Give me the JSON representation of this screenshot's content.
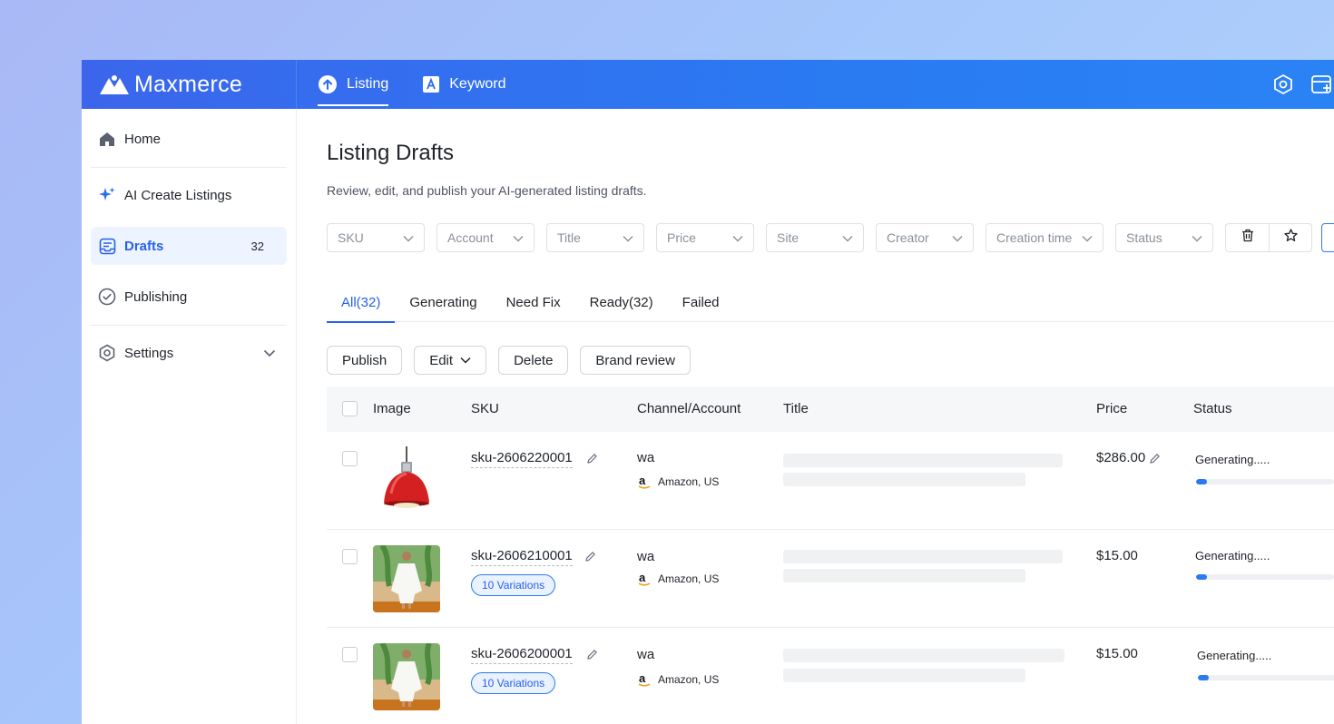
{
  "brand": {
    "name": "Maxmerce"
  },
  "topnav": {
    "tabs": [
      {
        "label": "Listing",
        "active": true
      },
      {
        "label": "Keyword",
        "active": false
      }
    ]
  },
  "sidebar": {
    "items": [
      {
        "label": "Home",
        "icon": "home-icon"
      },
      {
        "label": "AI Create Listings",
        "icon": "sparkle-icon"
      },
      {
        "label": "Drafts",
        "icon": "drafts-icon",
        "count": "32",
        "active": true
      },
      {
        "label": "Publishing",
        "icon": "check-circle-icon"
      },
      {
        "label": "Settings",
        "icon": "gear-icon"
      }
    ]
  },
  "page": {
    "title": "Listing Drafts",
    "subtitle": "Review, edit, and publish your AI-generated listing drafts."
  },
  "filters": [
    "SKU",
    "Account",
    "Title",
    "Price",
    "Site",
    "Creator",
    "Creation time",
    "Status"
  ],
  "tabs": [
    {
      "label": "All(32)",
      "active": true
    },
    {
      "label": "Generating"
    },
    {
      "label": "Need Fix"
    },
    {
      "label": "Ready(32)"
    },
    {
      "label": "Failed"
    }
  ],
  "actions": {
    "publish": "Publish",
    "edit": "Edit",
    "delete": "Delete",
    "brand_review": "Brand review"
  },
  "table": {
    "columns": {
      "image": "Image",
      "sku": "SKU",
      "channel": "Channel/Account",
      "title": "Title",
      "price": "Price",
      "status": "Status"
    },
    "rows": [
      {
        "sku": "sku-2606220001",
        "variations": "",
        "account": "wa",
        "channel": "Amazon, US",
        "price": "$286.00",
        "status": "Generating.....",
        "progress": 0.08,
        "image": "red-pendant-lamp"
      },
      {
        "sku": "sku-2606210001",
        "variations": "10 Variations",
        "account": "wa",
        "channel": "Amazon, US",
        "price": "$15.00",
        "status": "Generating.....",
        "progress": 0.08,
        "image": "white-beach-coverup"
      },
      {
        "sku": "sku-2606200001",
        "variations": "10 Variations",
        "account": "wa",
        "channel": "Amazon, US",
        "price": "$15.00",
        "status": "Generating.....",
        "progress": 0.08,
        "image": "white-beach-coverup"
      }
    ]
  },
  "colors": {
    "accent": "#2561e8",
    "topbar": "#2a7af2"
  }
}
